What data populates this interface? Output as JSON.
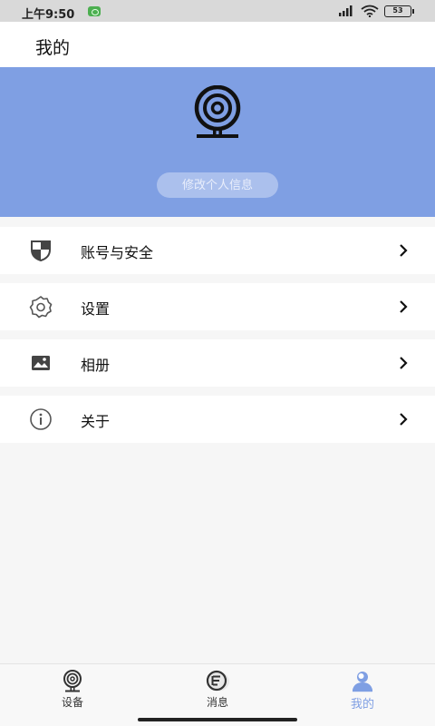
{
  "status_bar": {
    "time": "上午9:50",
    "battery": "53",
    "icons": [
      "notification-icon",
      "signal-icon",
      "wifi-icon",
      "battery-icon"
    ]
  },
  "header": {
    "title": "我的"
  },
  "profile": {
    "avatar_icon": "webcam-icon",
    "edit_label": "修改个人信息",
    "background_color": "#7f9fe3"
  },
  "menu": {
    "items": [
      {
        "label": "账号与安全",
        "icon": "shield-icon"
      },
      {
        "label": "设置",
        "icon": "gear-icon"
      },
      {
        "label": "相册",
        "icon": "image-icon"
      },
      {
        "label": "关于",
        "icon": "info-icon"
      }
    ]
  },
  "tabbar": {
    "tabs": [
      {
        "label": "设备",
        "icon": "device-icon",
        "active": false
      },
      {
        "label": "消息",
        "icon": "message-icon",
        "active": false
      },
      {
        "label": "我的",
        "icon": "profile-icon",
        "active": true
      }
    ],
    "active_color": "#7f9fe3"
  }
}
